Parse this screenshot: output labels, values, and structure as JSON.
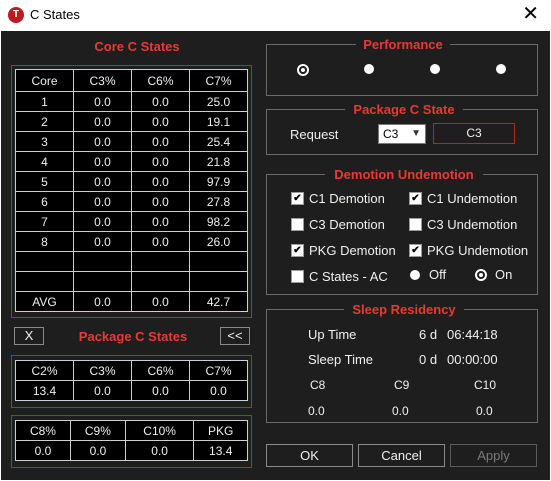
{
  "window": {
    "title": "C States",
    "icon_letter": "T"
  },
  "core_c_states": {
    "title": "Core C States",
    "headers": [
      "Core",
      "C3%",
      "C6%",
      "C7%"
    ],
    "rows": [
      [
        "1",
        "0.0",
        "0.0",
        "25.0"
      ],
      [
        "2",
        "0.0",
        "0.0",
        "19.1"
      ],
      [
        "3",
        "0.0",
        "0.0",
        "25.4"
      ],
      [
        "4",
        "0.0",
        "0.0",
        "21.8"
      ],
      [
        "5",
        "0.0",
        "0.0",
        "97.9"
      ],
      [
        "6",
        "0.0",
        "0.0",
        "27.8"
      ],
      [
        "7",
        "0.0",
        "0.0",
        "98.2"
      ],
      [
        "8",
        "0.0",
        "0.0",
        "26.0"
      ],
      [
        "",
        "",
        "",
        ""
      ],
      [
        "",
        "",
        "",
        ""
      ],
      [
        "AVG",
        "0.0",
        "0.0",
        "42.7"
      ]
    ]
  },
  "package_c_states": {
    "title": "Package C States",
    "x_button": "X",
    "back_button": "<<",
    "table1": {
      "headers": [
        "C2%",
        "C3%",
        "C6%",
        "C7%"
      ],
      "values": [
        "13.4",
        "0.0",
        "0.0",
        "0.0"
      ]
    },
    "table2": {
      "headers": [
        "C8%",
        "C9%",
        "C10%",
        "PKG"
      ],
      "values": [
        "0.0",
        "0.0",
        "0.0",
        "13.4"
      ]
    }
  },
  "performance": {
    "title": "Performance",
    "selected_index": 0,
    "option_count": 4
  },
  "package_c_state": {
    "title": "Package C State",
    "request_label": "Request",
    "select_value": "C3",
    "current_value": "C3"
  },
  "demotion": {
    "title": "Demotion Undemotion",
    "c1_demotion": {
      "label": "C1 Demotion",
      "checked": true
    },
    "c1_undemotion": {
      "label": "C1 Undemotion",
      "checked": true
    },
    "c3_demotion": {
      "label": "C3 Demotion",
      "checked": false
    },
    "c3_undemotion": {
      "label": "C3 Undemotion",
      "checked": false
    },
    "pkg_demotion": {
      "label": "PKG Demotion",
      "checked": true
    },
    "pkg_undemotion": {
      "label": "PKG Undemotion",
      "checked": true
    },
    "cstates_ac": {
      "label": "C States - AC",
      "checked": false
    },
    "off_label": "Off",
    "on_label": "On",
    "on_selected": true
  },
  "sleep_residency": {
    "title": "Sleep Residency",
    "uptime_label": "Up Time",
    "uptime_days": "6 d",
    "uptime_time": "06:44:18",
    "sleep_label": "Sleep Time",
    "sleep_days": "0 d",
    "sleep_time": "00:00:00",
    "c_headers": [
      "C8",
      "C9",
      "C10"
    ],
    "c_values": [
      "0.0",
      "0.0",
      "0.0"
    ]
  },
  "buttons": {
    "ok": "OK",
    "cancel": "Cancel",
    "apply": "Apply"
  }
}
